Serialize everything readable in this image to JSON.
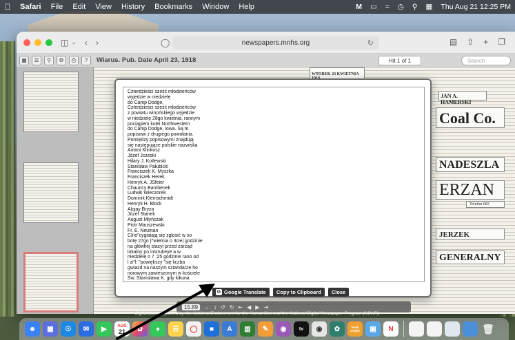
{
  "menubar": {
    "app": "Safari",
    "items": [
      "File",
      "Edit",
      "View",
      "History",
      "Bookmarks",
      "Window",
      "Help"
    ],
    "clock": "Thu Aug 21  12:25 PM"
  },
  "browser": {
    "url": "newspapers.mnhs.org"
  },
  "viewer": {
    "title": "Wiarus. Pub. Date April 23, 1918",
    "hit_count": "Hit 1 of 1",
    "search_placeholder": "Search",
    "zoom": "15.89",
    "footer": "Digitization supported by the National Endowment for the Humanities and the National Digital Newspaper Program (NDNP)."
  },
  "newspaper": {
    "header_frag": "WTOREK 23 KWIETNIA 1918",
    "coal": "Coal Co.",
    "jan": "JAN A. HAMERSKI",
    "nadeszla": "NADESZLA",
    "erzan": "ERZAN",
    "telefon": "Telefon 683",
    "jerzek": "JERZEK",
    "generalny": "GENERALNY"
  },
  "ocr": {
    "lines": [
      "Czterdzieści sześć młodzieńców",
      "wyjedzie w niedzielę",
      "do Camp Dodge.",
      "Czterdzieści sześć młodzieńców",
      "z powiatu winońskiego wyjedzie",
      "w niedzielę 28go kwietnia, rannym",
      "pociągiem kolei Northwestern",
      "do Camp Dodge, Iowa. Są to",
      "popisowi z drugiego powołania.",
      "Pomiędzy popisowymi znajdują",
      "się następujące polskie nazwiska",
      "Antoni Klinkosz",
      "Józef Jczeski",
      "Hilary J. Kotlewski",
      "Stanisław Pałubicki",
      "Franciszek K. Myszka",
      "Franciszek Herek",
      "Henryk A. JSfeier",
      "Chauncy Bambenek",
      "Ludwik Wieczorek",
      "Dominik Kleinschmidt",
      "Henryk H. Block",
      "Alojay Bryza",
      "Józef Stanek",
      "August Młyńczak",
      "Piotr Mauszewski",
      "Fr. E. Neuman",
      "CIi!o\"cygiaiają się zgłosić w so",
      "botę 27go |^wietnia o 3cie| godzinie",
      "na główfiej stacyi przed zarząd",
      "lokalny po instrukeye a w",
      "niedzielę o 7 :25 godzinie rano od",
      "l zi\"l: \"powiększy \"się liczba",
      "gwiazd na naszym sztandarze ho",
      "norowym zawieszonym w kościele",
      "Św. Stanisława K. gdy kikuna"
    ],
    "buttons": {
      "translate": "Google Translate",
      "copy": "Copy to Clipboard",
      "close": "Close"
    }
  },
  "dock": {
    "calendar_month": "AUG",
    "calendar_day": "21",
    "book_label": "book wright"
  },
  "colors": {
    "dialog_button_bg": "#333333",
    "selected_thumb_border": "#d97c7c",
    "arrow": "#000000"
  }
}
